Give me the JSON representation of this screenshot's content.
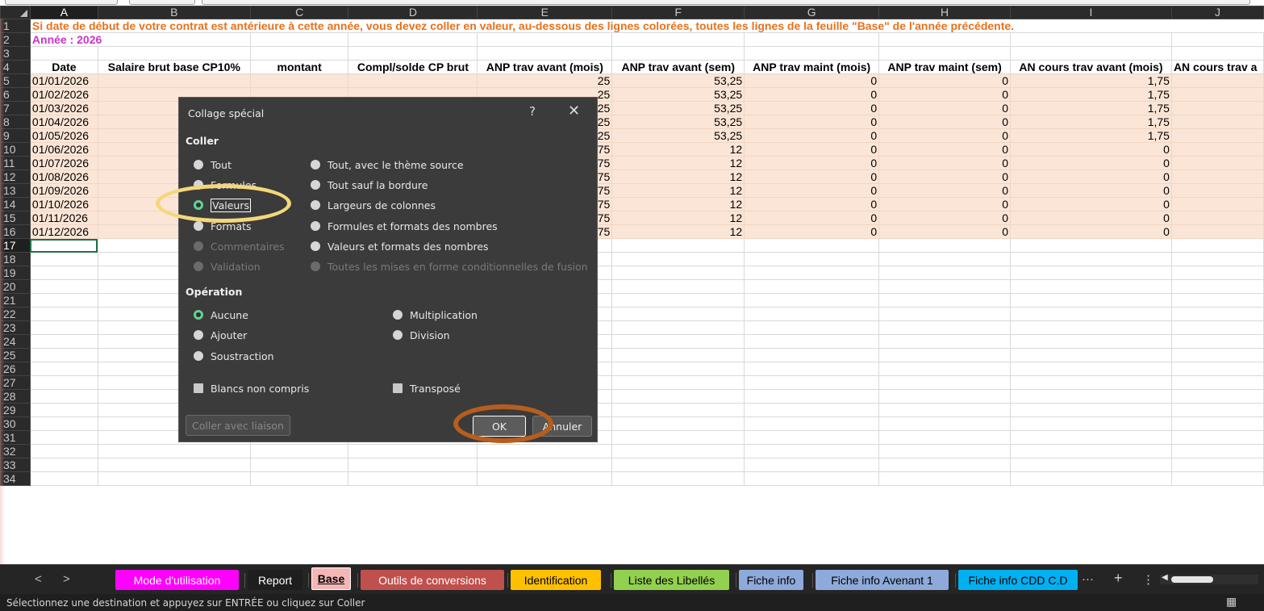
{
  "columns": [
    "A",
    "B",
    "C",
    "D",
    "E",
    "F",
    "G",
    "H",
    "I",
    "J"
  ],
  "rows": {
    "row1": {
      "num": "1",
      "text": "Si date de début de votre contrat est antérieure à cette année, vous devez coller en valeur, au-dessous des lignes colorées, toutes les lignes de la feuille \"Base\" de l'année précédente."
    },
    "row2": {
      "num": "2",
      "text": "Année : 2026"
    },
    "row3": {
      "num": "3"
    },
    "header": {
      "num": "4",
      "cells": [
        "Date",
        "Salaire brut base CP10%",
        "montant",
        "Compl/solde CP brut",
        "ANP trav avant (mois)",
        "ANP trav avant (sem)",
        "ANP trav maint (mois)",
        "ANP trav maint (sem)",
        "AN cours trav avant (mois)",
        "AN cours trav a"
      ]
    },
    "data": [
      {
        "num": "5",
        "date": "01/01/2026",
        "e": "25",
        "f": "53,25",
        "g": "0",
        "h": "0",
        "i": "1,75"
      },
      {
        "num": "6",
        "date": "01/02/2026",
        "e": "25",
        "f": "53,25",
        "g": "0",
        "h": "0",
        "i": "1,75"
      },
      {
        "num": "7",
        "date": "01/03/2026",
        "e": "25",
        "f": "53,25",
        "g": "0",
        "h": "0",
        "i": "1,75"
      },
      {
        "num": "8",
        "date": "01/04/2026",
        "e": "25",
        "f": "53,25",
        "g": "0",
        "h": "0",
        "i": "1,75"
      },
      {
        "num": "9",
        "date": "01/05/2026",
        "e": "25",
        "f": "53,25",
        "g": "0",
        "h": "0",
        "i": "1,75"
      },
      {
        "num": "10",
        "date": "01/06/2026",
        "e": "75",
        "f": "12",
        "g": "0",
        "h": "0",
        "i": "0"
      },
      {
        "num": "11",
        "date": "01/07/2026",
        "e": "75",
        "f": "12",
        "g": "0",
        "h": "0",
        "i": "0"
      },
      {
        "num": "12",
        "date": "01/08/2026",
        "e": "75",
        "f": "12",
        "g": "0",
        "h": "0",
        "i": "0"
      },
      {
        "num": "13",
        "date": "01/09/2026",
        "e": "75",
        "f": "12",
        "g": "0",
        "h": "0",
        "i": "0"
      },
      {
        "num": "14",
        "date": "01/10/2026",
        "e": "75",
        "f": "12",
        "g": "0",
        "h": "0",
        "i": "0"
      },
      {
        "num": "15",
        "date": "01/11/2026",
        "e": "75",
        "f": "12",
        "g": "0",
        "h": "0",
        "i": "0"
      },
      {
        "num": "16",
        "date": "01/12/2026",
        "e": "75",
        "f": "12",
        "g": "0",
        "h": "0",
        "i": "0"
      }
    ],
    "empty": [
      "17",
      "18",
      "19",
      "20",
      "21",
      "22",
      "23",
      "24",
      "25",
      "26",
      "27",
      "28",
      "29",
      "30",
      "31",
      "32",
      "33",
      "34"
    ]
  },
  "dialog": {
    "title": "Collage spécial",
    "help": "?",
    "close": "✕",
    "coller_label": "Coller",
    "coller_left": [
      "Tout",
      "Formules",
      "Valeurs",
      "Formats",
      "Commentaires",
      "Validation"
    ],
    "coller_right": [
      "Tout, avec le thème source",
      "Tout sauf la bordure",
      "Largeurs de colonnes",
      "Formules et formats des nombres",
      "Valeurs et formats des nombres",
      "Toutes les mises en forme conditionnelles de fusion"
    ],
    "selected_coller": "Valeurs",
    "operation_label": "Opération",
    "operation_left": [
      "Aucune",
      "Ajouter",
      "Soustraction"
    ],
    "operation_right": [
      "Multiplication",
      "Division"
    ],
    "selected_operation": "Aucune",
    "blancs": "Blancs non compris",
    "transpose": "Transposé",
    "link_button": "Coller avec liaison",
    "ok_button": "OK",
    "cancel_button": "Annuler"
  },
  "tabs": [
    {
      "label": "Mode d'utilisation",
      "bg": "#ff00ff",
      "fg": "#ffffff"
    },
    {
      "label": "Report",
      "bg": "#1e1e1e",
      "fg": "#ffffff"
    },
    {
      "label": "Base",
      "bg": "#f4b6b6",
      "fg": "#000000",
      "active": true
    },
    {
      "label": "Outils de conversions",
      "bg": "#c0504d",
      "fg": "#ffffff"
    },
    {
      "label": "Identification",
      "bg": "#ffc000",
      "fg": "#000000"
    },
    {
      "label": "Liste des Libellés",
      "bg": "#92d050",
      "fg": "#000000"
    },
    {
      "label": "Fiche info",
      "bg": "#8eaadb",
      "fg": "#000000"
    },
    {
      "label": "Fiche info Avenant 1",
      "bg": "#8eaadb",
      "fg": "#000000"
    },
    {
      "label": "Fiche info CDD C.D",
      "bg": "#00b0f0",
      "fg": "#000000"
    }
  ],
  "tab_nav": {
    "prev": "<",
    "next": ">",
    "more": "···",
    "add": "+",
    "options": "⋮"
  },
  "status": {
    "message": "Sélectionnez une destination et appuyez sur ENTRÉE ou cliquez sur Coller",
    "view_icon": "▦"
  },
  "colors": {
    "banner": "#e9711c",
    "annee": "#cc33cc",
    "data_fill": "#fbe5d6",
    "ok_ring": "#b55e1e",
    "valeurs_ring": "#f4d77a",
    "radio_selected": "#5fd490"
  }
}
